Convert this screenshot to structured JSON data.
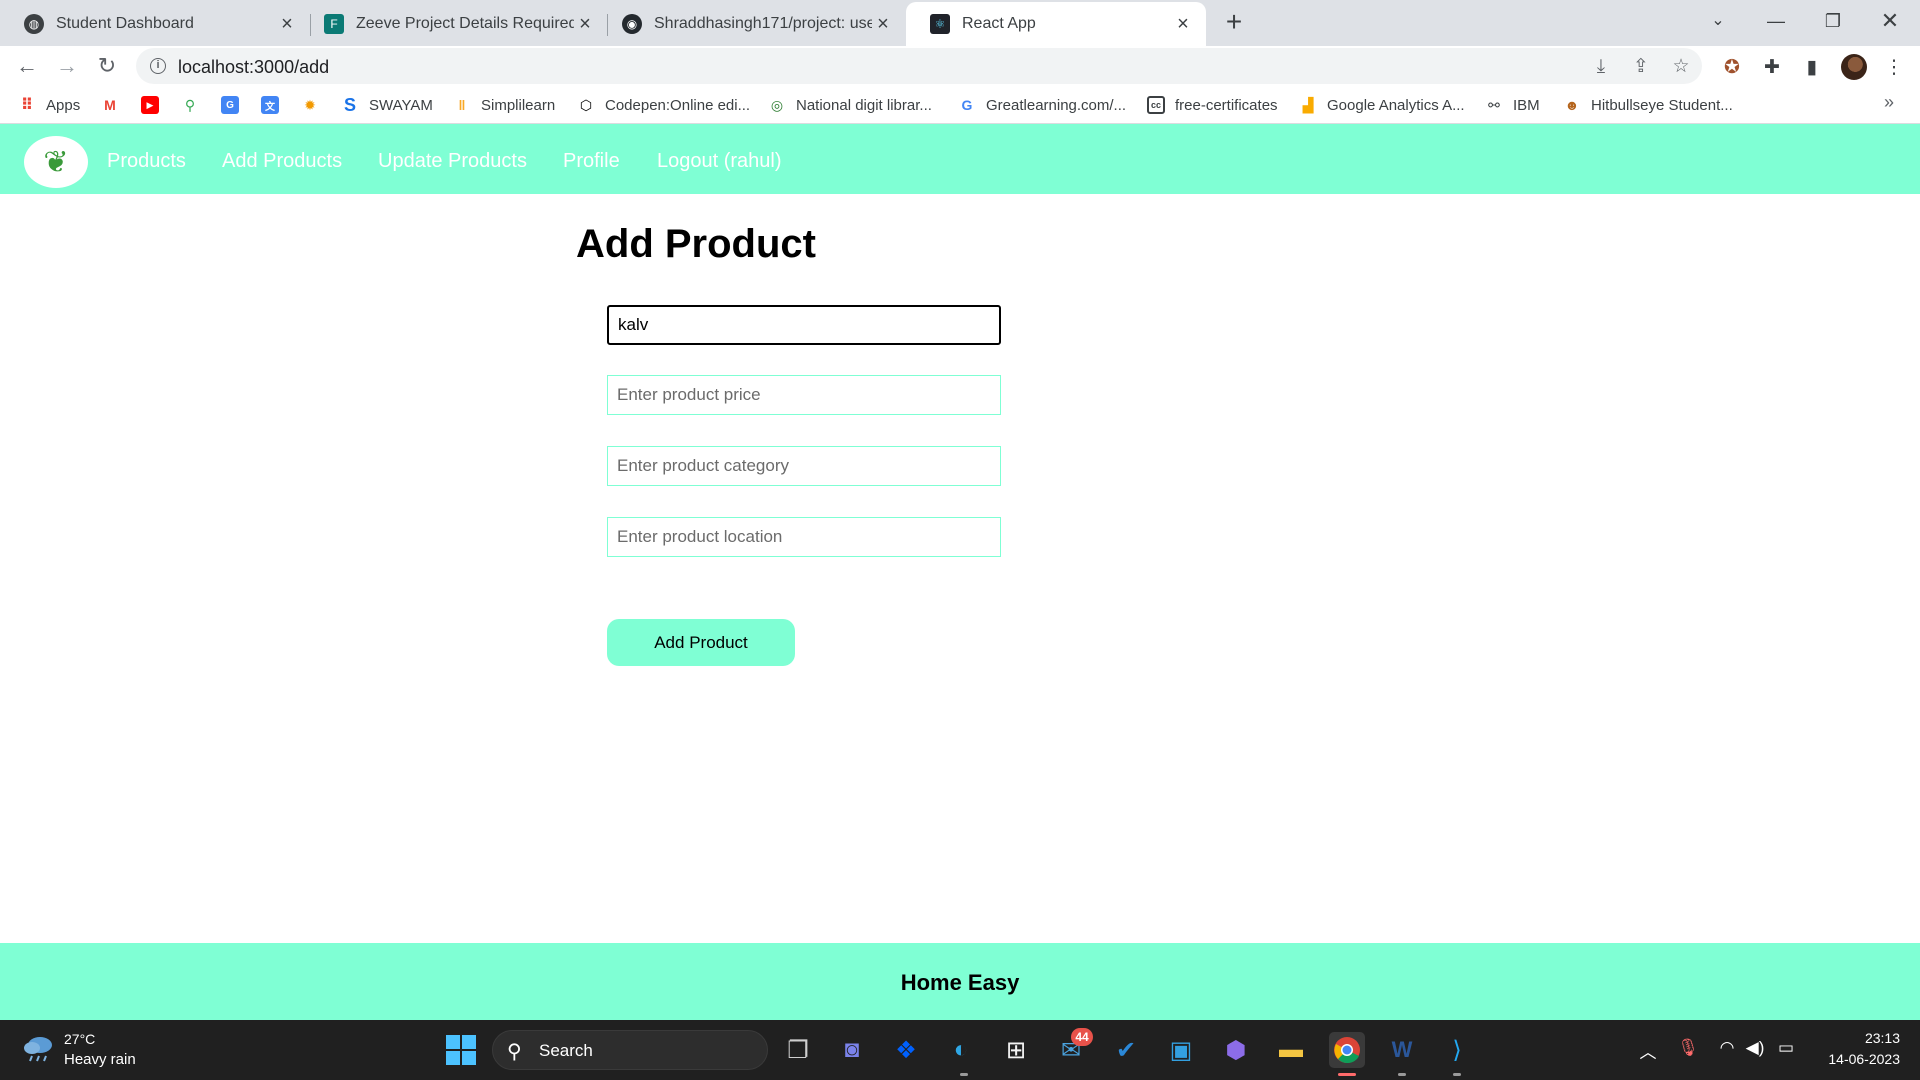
{
  "browser": {
    "tabs": [
      {
        "title": "Student Dashboard",
        "icon": "globe-icon"
      },
      {
        "title": "Zeeve Project Details Required :",
        "icon": "forms-icon"
      },
      {
        "title": "Shraddhasingh171/project: uses",
        "icon": "github-icon"
      },
      {
        "title": "React App",
        "icon": "react-icon",
        "active": true
      }
    ],
    "new_tab_symbol": "+",
    "url": "localhost:3000/add",
    "bookmarks": [
      {
        "label": "Apps",
        "icon": "apps-grid-icon"
      },
      {
        "label": "",
        "icon": "gmail-icon"
      },
      {
        "label": "",
        "icon": "youtube-icon"
      },
      {
        "label": "",
        "icon": "maps-icon"
      },
      {
        "label": "",
        "icon": "google-forms-icon"
      },
      {
        "label": "",
        "icon": "google-translate-icon"
      },
      {
        "label": "",
        "icon": "bug-icon"
      },
      {
        "label": "SWAYAM",
        "icon": "swayam-icon"
      },
      {
        "label": "Simplilearn",
        "icon": "simplilearn-icon"
      },
      {
        "label": "Codepen:Online edi...",
        "icon": "codepen-icon"
      },
      {
        "label": "National digit librar...",
        "icon": "ndl-icon"
      },
      {
        "label": "Greatlearning.com/...",
        "icon": "google-icon"
      },
      {
        "label": "free-certificates",
        "icon": "certificate-icon"
      },
      {
        "label": "Google Analytics A...",
        "icon": "analytics-icon"
      },
      {
        "label": "IBM",
        "icon": "ibm-icon"
      },
      {
        "label": "Hitbullseye Student...",
        "icon": "hitbullseye-icon"
      }
    ],
    "bookmarks_overflow": "»"
  },
  "app": {
    "nav": {
      "links": [
        "Products",
        "Add Products",
        "Update Products",
        "Profile",
        "Logout (rahul)"
      ]
    },
    "page_title": "Add Product",
    "form": {
      "name_value": "kalv",
      "price_placeholder": "Enter product price",
      "category_placeholder": "Enter product category",
      "location_placeholder": "Enter product location",
      "submit_label": "Add Product"
    },
    "footer_text": "Home Easy",
    "colors": {
      "accent": "#7fffd4",
      "nav_text": "#ffffff"
    }
  },
  "taskbar": {
    "weather": {
      "temp": "27°C",
      "desc": "Heavy rain"
    },
    "search_label": "Search",
    "mail_badge": "44",
    "clock": {
      "time": "23:13",
      "date": "14-06-2023"
    }
  }
}
